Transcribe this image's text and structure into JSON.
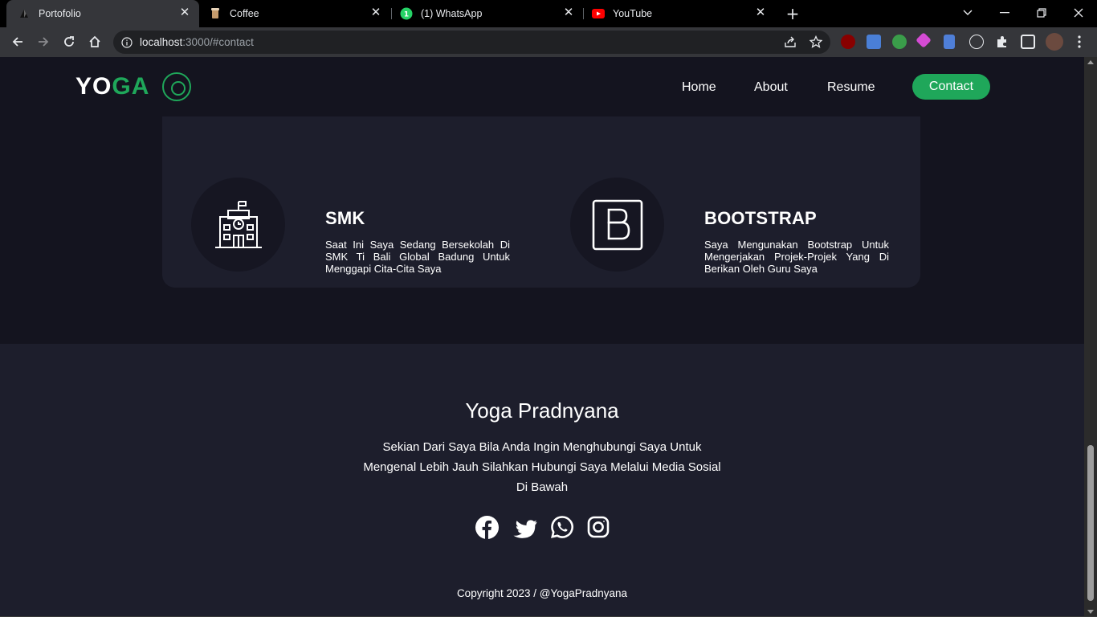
{
  "browser": {
    "tabs": [
      {
        "title": "Portofolio",
        "icon": "triangle-logo-icon",
        "active": true
      },
      {
        "title": "Coffee",
        "icon": "coffee-cup-icon",
        "active": false
      },
      {
        "title": "(1) WhatsApp",
        "icon": "whatsapp-icon",
        "active": false
      },
      {
        "title": "YouTube",
        "icon": "youtube-icon",
        "active": false
      }
    ],
    "url_host": "localhost",
    "url_rest": ":3000/#contact"
  },
  "nav": {
    "logo_a": "YO",
    "logo_b": "GA",
    "links": [
      "Home",
      "About",
      "Resume"
    ],
    "cta": "Contact"
  },
  "features": [
    {
      "title": "SMK",
      "desc": "Saat Ini Saya Sedang Bersekolah Di SMK Ti Bali Global Badung Untuk Menggapi Cita-Cita Saya",
      "icon": "school-building-icon"
    },
    {
      "title": "BOOTSTRAP",
      "desc": "Saya Mengunakan Bootstrap Untuk Mengerjakan Projek-Projek Yang Di Berikan Oleh Guru Saya",
      "icon": "bootstrap-icon"
    }
  ],
  "footer": {
    "name": "Yoga Pradnyana",
    "text": "Sekian Dari Saya Bila Anda Ingin Menghubungi Saya Untuk Mengenal Lebih Jauh Silahkan Hubungi Saya Melalui Media Sosial Di Bawah",
    "socials": [
      "facebook-icon",
      "twitter-icon",
      "whatsapp-icon",
      "instagram-icon"
    ],
    "copyright": "Copyright 2023 / @YogaPradnyana"
  },
  "colors": {
    "accent": "#1fa75a",
    "page_bg": "#14141f",
    "card_bg": "#1d1e2c"
  }
}
